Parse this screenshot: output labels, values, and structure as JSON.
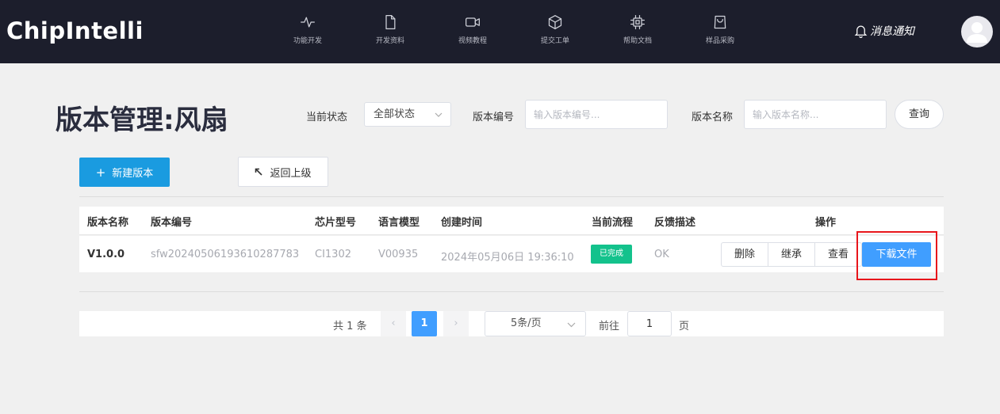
{
  "header": {
    "logo": "ChipIntelli",
    "nav": [
      {
        "label": "功能开发",
        "icon": "activity-icon"
      },
      {
        "label": "开发资料",
        "icon": "document-icon"
      },
      {
        "label": "视频教程",
        "icon": "video-icon"
      },
      {
        "label": "提交工单",
        "icon": "box-icon"
      },
      {
        "label": "帮助文档",
        "icon": "chip-icon"
      },
      {
        "label": "样品采购",
        "icon": "shopping-bag-icon"
      }
    ],
    "notify_label": "消息通知",
    "notify_icon": "bell-icon",
    "avatar_icon": "user-avatar-icon"
  },
  "page": {
    "title": "版本管理:风扇"
  },
  "filters": {
    "status_label": "当前状态",
    "status_value": "全部状态",
    "version_no_label": "版本编号",
    "version_no_placeholder": "输入版本编号...",
    "version_name_label": "版本名称",
    "version_name_placeholder": "输入版本名称...",
    "query_label": "查询"
  },
  "actions": {
    "new_label": "新建版本",
    "back_label": "返回上级"
  },
  "table": {
    "columns": [
      "版本名称",
      "版本编号",
      "芯片型号",
      "语言模型",
      "创建时间",
      "当前流程",
      "反馈描述",
      "操作"
    ],
    "rows": [
      {
        "name": "V1.0.0",
        "number": "sfw20240506193610287783",
        "chip": "CI1302",
        "model": "V00935",
        "created": "2024年05月06日 19:36:10",
        "status": "已完成",
        "feedback": "OK",
        "ops": [
          "删除",
          "继承",
          "查看"
        ],
        "download": "下载文件"
      }
    ]
  },
  "pagination": {
    "total": "共 1 条",
    "prev": "‹",
    "current": "1",
    "next": "›",
    "page_size": "5条/页",
    "goto_label": "前往",
    "goto_value": "1",
    "page_suffix": "页"
  },
  "colors": {
    "header_bg": "#1c1e2c",
    "primary": "#409eff",
    "new_button": "#1a9be0",
    "status_done": "#13c28c",
    "highlight": "#e8151b"
  }
}
